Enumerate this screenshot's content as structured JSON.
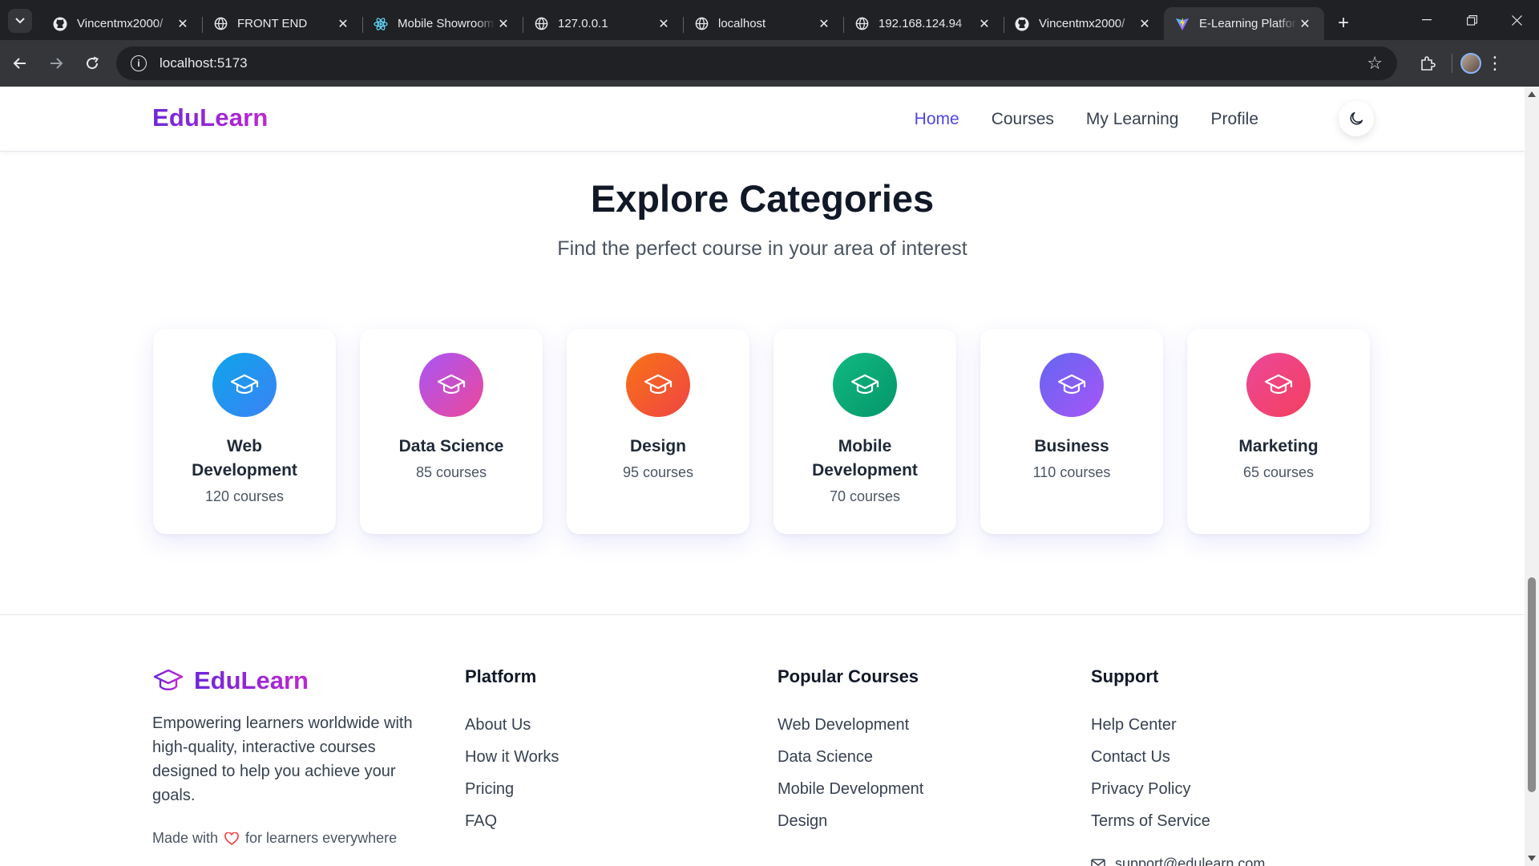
{
  "browser": {
    "tabs": [
      {
        "title": "Vincentmx2000/",
        "icon": "github-icon"
      },
      {
        "title": "FRONT END",
        "icon": "globe-icon"
      },
      {
        "title": "Mobile Showroom",
        "icon": "react-icon"
      },
      {
        "title": "127.0.0.1",
        "icon": "globe-icon"
      },
      {
        "title": "localhost",
        "icon": "globe-icon"
      },
      {
        "title": "192.168.124.94",
        "icon": "globe-icon"
      },
      {
        "title": "Vincentmx2000/",
        "icon": "github-icon"
      },
      {
        "title": "E-Learning Platform",
        "icon": "vite-icon",
        "active": true
      }
    ],
    "url": "localhost:5173"
  },
  "header": {
    "logo": "EduLearn",
    "nav": [
      "Home",
      "Courses",
      "My Learning",
      "Profile"
    ],
    "active_nav": "Home"
  },
  "categories": {
    "title": "Explore Categories",
    "subtitle": "Find the perfect course in your area of interest",
    "items": [
      {
        "name": "Web Development",
        "count": "120 courses",
        "icon": "graduation-cap-icon",
        "gradient": [
          "#0ea5e9",
          "#3b82f6"
        ]
      },
      {
        "name": "Data Science",
        "count": "85 courses",
        "icon": "graduation-cap-icon",
        "gradient": [
          "#a855f7",
          "#ec4899"
        ]
      },
      {
        "name": "Design",
        "count": "95 courses",
        "icon": "graduation-cap-icon",
        "gradient": [
          "#f97316",
          "#ef4444"
        ]
      },
      {
        "name": "Mobile Development",
        "count": "70 courses",
        "icon": "graduation-cap-icon",
        "gradient": [
          "#10b981",
          "#059669"
        ]
      },
      {
        "name": "Business",
        "count": "110 courses",
        "icon": "graduation-cap-icon",
        "gradient": [
          "#6366f1",
          "#a855f7"
        ]
      },
      {
        "name": "Marketing",
        "count": "65 courses",
        "icon": "graduation-cap-icon",
        "gradient": [
          "#ec4899",
          "#f43f5e"
        ]
      }
    ]
  },
  "footer": {
    "brand": "EduLearn",
    "description": "Empowering learners worldwide with high-quality, interactive courses designed to help you achieve your goals.",
    "made_with_prefix": "Made with",
    "made_with_suffix": "for learners everywhere",
    "columns": [
      {
        "heading": "Platform",
        "links": [
          "About Us",
          "How it Works",
          "Pricing",
          "FAQ"
        ]
      },
      {
        "heading": "Popular Courses",
        "links": [
          "Web Development",
          "Data Science",
          "Mobile Development",
          "Design"
        ]
      },
      {
        "heading": "Support",
        "links": [
          "Help Center",
          "Contact Us",
          "Privacy Policy",
          "Terms of Service"
        ]
      }
    ],
    "email": "support@edulearn.com"
  },
  "colors": {
    "accent": "#4f46e5",
    "brand_gradient": [
      "#6d28d9",
      "#c026d3"
    ],
    "heart": "#ef4444"
  }
}
